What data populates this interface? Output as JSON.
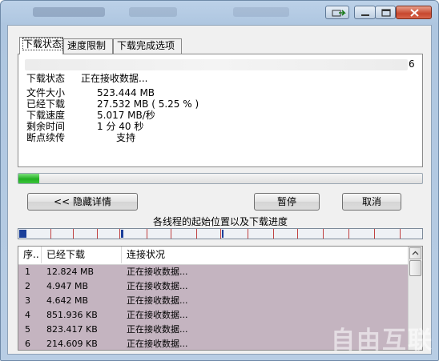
{
  "tabs": [
    {
      "label": "下载状态"
    },
    {
      "label": "速度限制"
    },
    {
      "label": "下载完成选项"
    }
  ],
  "status": {
    "url_tail": "6",
    "status_label": "下载状态",
    "status_value": "正在接收数据...",
    "file_size_label": "文件大小",
    "file_size_value": "523.444  MB",
    "downloaded_label": "已经下载",
    "downloaded_value": "27.532  MB  ( 5.25 % )",
    "speed_label": "下载速度",
    "speed_value": "5.017  MB/秒",
    "remaining_label": "剩余时间",
    "remaining_value": "1 分 40 秒",
    "resume_label": "断点续传",
    "resume_value": "支持"
  },
  "progress": {
    "percent": 5.25,
    "color": "#22b022"
  },
  "buttons": {
    "hide_details": "<< 隐藏详情",
    "pause": "暂停",
    "cancel": "取消"
  },
  "threads_title": "各线程的起始位置以及下载进度",
  "thread_list": {
    "headers": [
      "序..",
      "已经下载",
      "连接状况"
    ],
    "rows": [
      {
        "num": "1",
        "downloaded": "12.824 MB",
        "status": "正在接收数据..."
      },
      {
        "num": "2",
        "downloaded": "4.947 MB",
        "status": "正在接收数据..."
      },
      {
        "num": "3",
        "downloaded": "4.642 MB",
        "status": "正在接收数据..."
      },
      {
        "num": "4",
        "downloaded": "851.936 KB",
        "status": "正在接收数据..."
      },
      {
        "num": "5",
        "downloaded": "823.417 KB",
        "status": "正在接收数据..."
      },
      {
        "num": "6",
        "downloaded": "214.609 KB",
        "status": "正在接收数据..."
      }
    ]
  },
  "watermark": "自由互联",
  "colors": {
    "accent": "#1a3f9a",
    "row_bg": "#c4b4c0"
  }
}
